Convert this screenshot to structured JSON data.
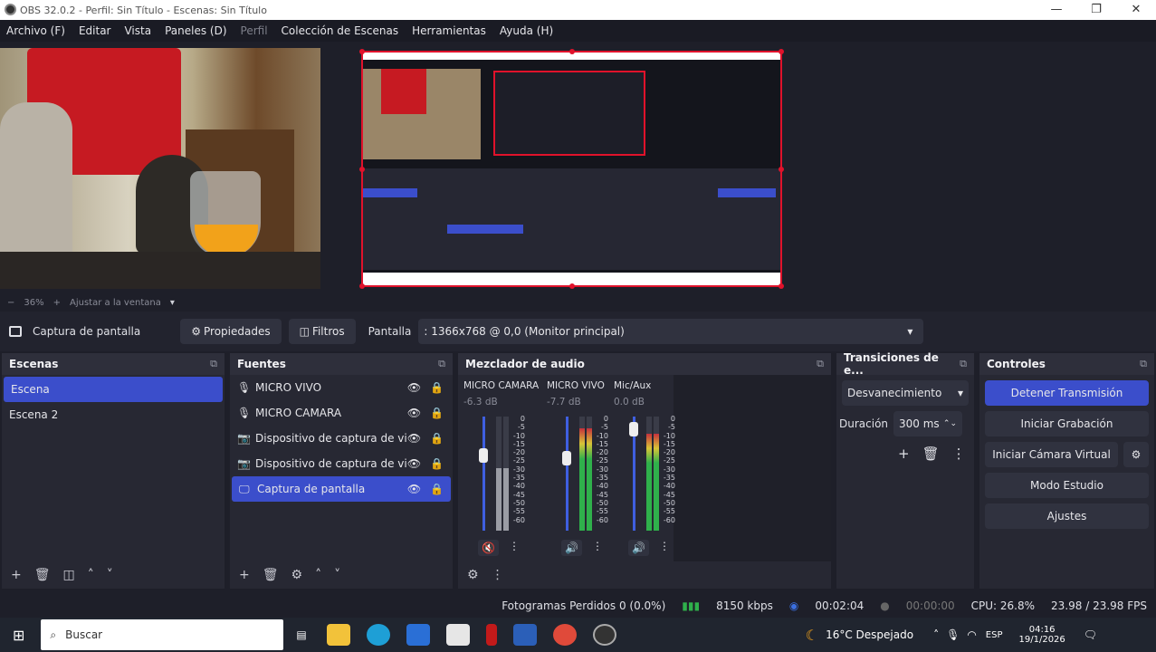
{
  "window": {
    "title": "OBS 32.0.2 - Perfil: Sin Título - Escenas: Sin Título"
  },
  "menu": [
    "Archivo (F)",
    "Editar",
    "Vista",
    "Paneles (D)",
    "Perfil",
    "Colección de Escenas",
    "Herramientas",
    "Ayuda (H)"
  ],
  "zoombar": {
    "minus": "−",
    "zoom": "36%",
    "plus": "+",
    "fit": "Ajustar a la ventana"
  },
  "source_bar": {
    "selected_source": "Captura de pantalla",
    "properties": "Propiedades",
    "filters": "Filtros",
    "display_label": "Pantalla",
    "display_value": ": 1366x768 @ 0,0 (Monitor principal)"
  },
  "scenes": {
    "title": "Escenas",
    "items": [
      "Escena",
      "Escena 2"
    ]
  },
  "sources": {
    "title": "Fuentes",
    "items": [
      "MICRO VIVO",
      "MICRO CAMARA",
      "Dispositivo de captura de vid",
      "Dispositivo de captura de vid",
      "Captura de pantalla"
    ]
  },
  "mixer": {
    "title": "Mezclador de audio",
    "channels": [
      {
        "name": "MICRO CAMARA",
        "db": "-6.3 dB",
        "level": 0.55,
        "slider": 0.72,
        "muted": true
      },
      {
        "name": "MICRO VIVO",
        "db": "-7.7 dB",
        "level": 0.9,
        "slider": 0.7,
        "muted": false
      },
      {
        "name": "Mic/Aux",
        "db": "0.0 dB",
        "level": 0.85,
        "slider": 0.95,
        "muted": false
      }
    ],
    "scale": [
      "0",
      "-5",
      "-10",
      "-15",
      "-20",
      "-25",
      "-30",
      "-35",
      "-40",
      "-45",
      "-50",
      "-55",
      "-60"
    ]
  },
  "transitions": {
    "title": "Transiciones de e...",
    "type": "Desvanecimiento",
    "duration_label": "Duración",
    "duration_value": "300 ms"
  },
  "controls": {
    "title": "Controles",
    "buttons": [
      "Detener Transmisión",
      "Iniciar Grabación",
      "Iniciar Cámara Virtual",
      "Modo Estudio",
      "Ajustes"
    ]
  },
  "status": {
    "dropped": "Fotogramas Perdidos 0 (0.0%)",
    "bitrate": "8150 kbps",
    "stream_time": "00:02:04",
    "rec_time": "00:00:00",
    "cpu": "CPU: 26.8%",
    "fps": "23.98 / 23.98 FPS"
  },
  "taskbar": {
    "search": "Buscar",
    "weather": "16°C  Despejado",
    "lang": "ESP",
    "time": "04:16",
    "date": "19/1/2026"
  },
  "colors": {
    "accent": "#3b4ecb",
    "selection_border": "#e0122b",
    "bg": "#1e1f29",
    "panel": "#272833"
  }
}
